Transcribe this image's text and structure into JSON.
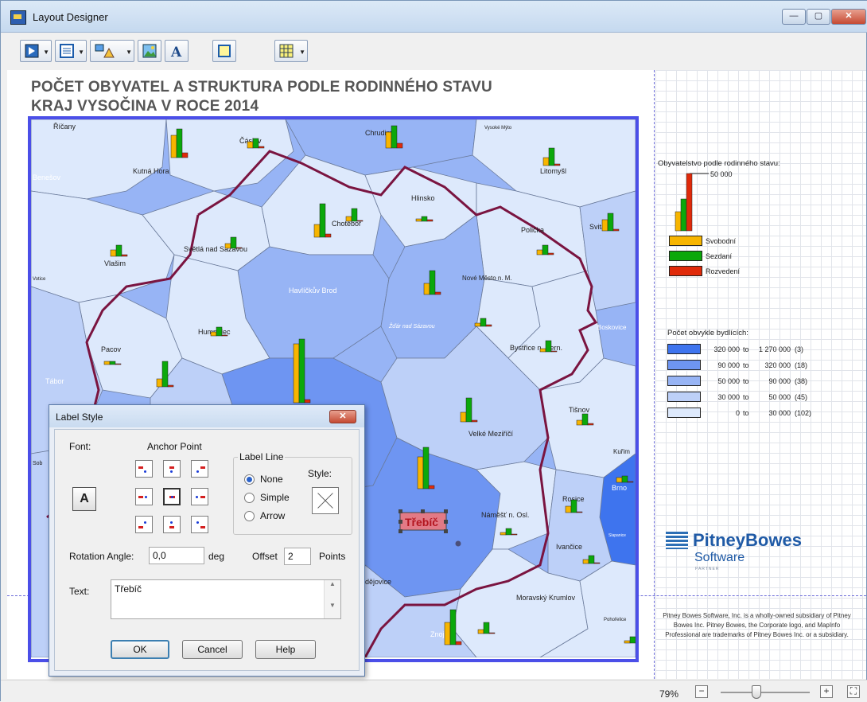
{
  "window": {
    "title": "Layout Designer",
    "controls": [
      "—",
      "▢",
      "✕"
    ]
  },
  "toolbar": {
    "buttons": [
      "select-tool",
      "frame-tool",
      "drawing-tool",
      "image-tool",
      "text-tool",
      "frame-border-tool",
      "grid-tool"
    ]
  },
  "layout": {
    "title_line1": "POČET OBYVATEL A STRUKTURA PODLE RODINNÉHO STAVU",
    "title_line2": "KRAJ VYSOČINA V ROCE 2014"
  },
  "map": {
    "labels": [
      "Říčany",
      "Čáslav",
      "Chrudim",
      "Vysoké Mýto",
      "Benešov",
      "Kutná Hora",
      "Litomyšl",
      "Hlinsko",
      "Chotěboř",
      "Světlá nad Sázavou",
      "Vlašim",
      "Votice",
      "Polička",
      "Svitavy",
      "Havlíčkův Brod",
      "Nové Město n. M.",
      "Humpolec",
      "Žďár nad Sázavou",
      "Boskovice",
      "Pacov",
      "Bystřice n. Pern.",
      "Tábor",
      "Tišnov",
      "Velké Meziříčí",
      "Kuřim",
      "Sob",
      "Brno",
      "Rosice",
      "Náměšť n. Osl.",
      "Třebíč",
      "Ivančice",
      "Slapanice",
      "Moravský Krumlov",
      "dějovice",
      "Pohořelice",
      "Znojmo"
    ],
    "selected_label": "Třebíč"
  },
  "legend": {
    "chart_title": "Obyvatelstvo podle rodinného stavu:",
    "chart_scale": "50 000",
    "series": [
      {
        "name": "Svobodní",
        "color": "#F7B500"
      },
      {
        "name": "Sezdaní",
        "color": "#0BA80B"
      },
      {
        "name": "Rozvedení",
        "color": "#E02A0A"
      }
    ],
    "ranges_title": "Počet obvykle bydlících:",
    "ranges": [
      {
        "from": "320 000",
        "to": "1 270 000",
        "count": "(3)",
        "color": "#3E74EE"
      },
      {
        "from": "90 000",
        "to": "320 000",
        "count": "(18)",
        "color": "#6E95F2"
      },
      {
        "from": "50 000",
        "to": "90 000",
        "count": "(38)",
        "color": "#97B4F5"
      },
      {
        "from": "30 000",
        "to": "50 000",
        "count": "(45)",
        "color": "#BDD0F8"
      },
      {
        "from": "0",
        "to": "30 000",
        "count": "(102)",
        "color": "#DDE9FC"
      }
    ],
    "to_word": "to"
  },
  "logo": {
    "name": "PitneyBowes",
    "sub": "Software",
    "partner": "PARTNER"
  },
  "disclaimer": "Pitney Bowes Software, Inc. is a wholly-owned subsidiary of Pitney Bowes Inc. Pitney Bowes, the Corporate logo, and MapInfo Professional are trademarks of Pitney Bowes Inc. or a subsidiary.",
  "status": {
    "zoom": "79%",
    "zoom_level": 0.45
  },
  "dialog": {
    "title": "Label Style",
    "font_label": "Font:",
    "font_button": "A",
    "anchor_label": "Anchor Point",
    "label_line_label": "Label Line",
    "style_label": "Style:",
    "options": [
      "None",
      "Simple",
      "Arrow"
    ],
    "selected_option": "None",
    "rotation_label": "Rotation Angle:",
    "rotation_value": "0,0",
    "deg_label": "deg",
    "offset_label": "Offset",
    "offset_value": "2",
    "points_label": "Points",
    "text_label": "Text:",
    "text_value": "Třebíč",
    "ok": "OK",
    "cancel": "Cancel",
    "help": "Help"
  }
}
